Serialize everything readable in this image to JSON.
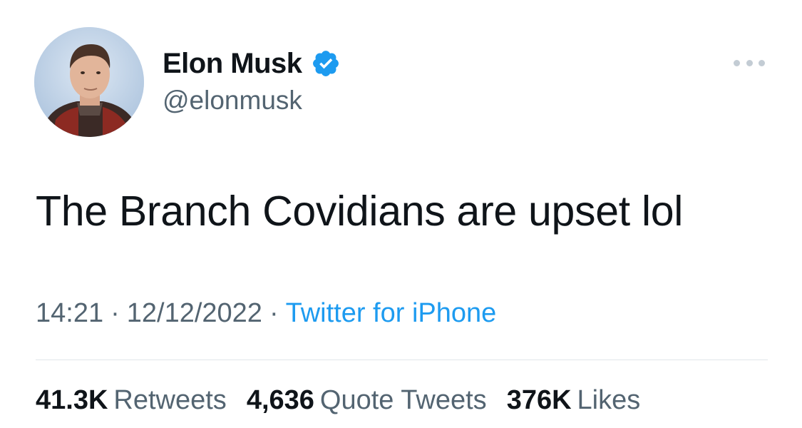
{
  "author": {
    "display_name": "Elon Musk",
    "handle": "@elonmusk",
    "verified": true
  },
  "tweet": {
    "text": "The Branch Covidians are upset lol"
  },
  "meta": {
    "time": "14:21",
    "separator": "·",
    "date": "12/12/2022",
    "source": "Twitter for iPhone"
  },
  "stats": {
    "retweets_count": "41.3K",
    "retweets_label": "Retweets",
    "quotes_count": "4,636",
    "quotes_label": "Quote Tweets",
    "likes_count": "376K",
    "likes_label": "Likes"
  },
  "colors": {
    "text": "#0f1419",
    "secondary": "#536471",
    "link": "#1d9bf0",
    "verified_badge": "#1d9bf0",
    "divider": "#e1e6ea"
  },
  "icons": {
    "verified": "verified-badge-icon",
    "more": "more-dots-icon"
  }
}
